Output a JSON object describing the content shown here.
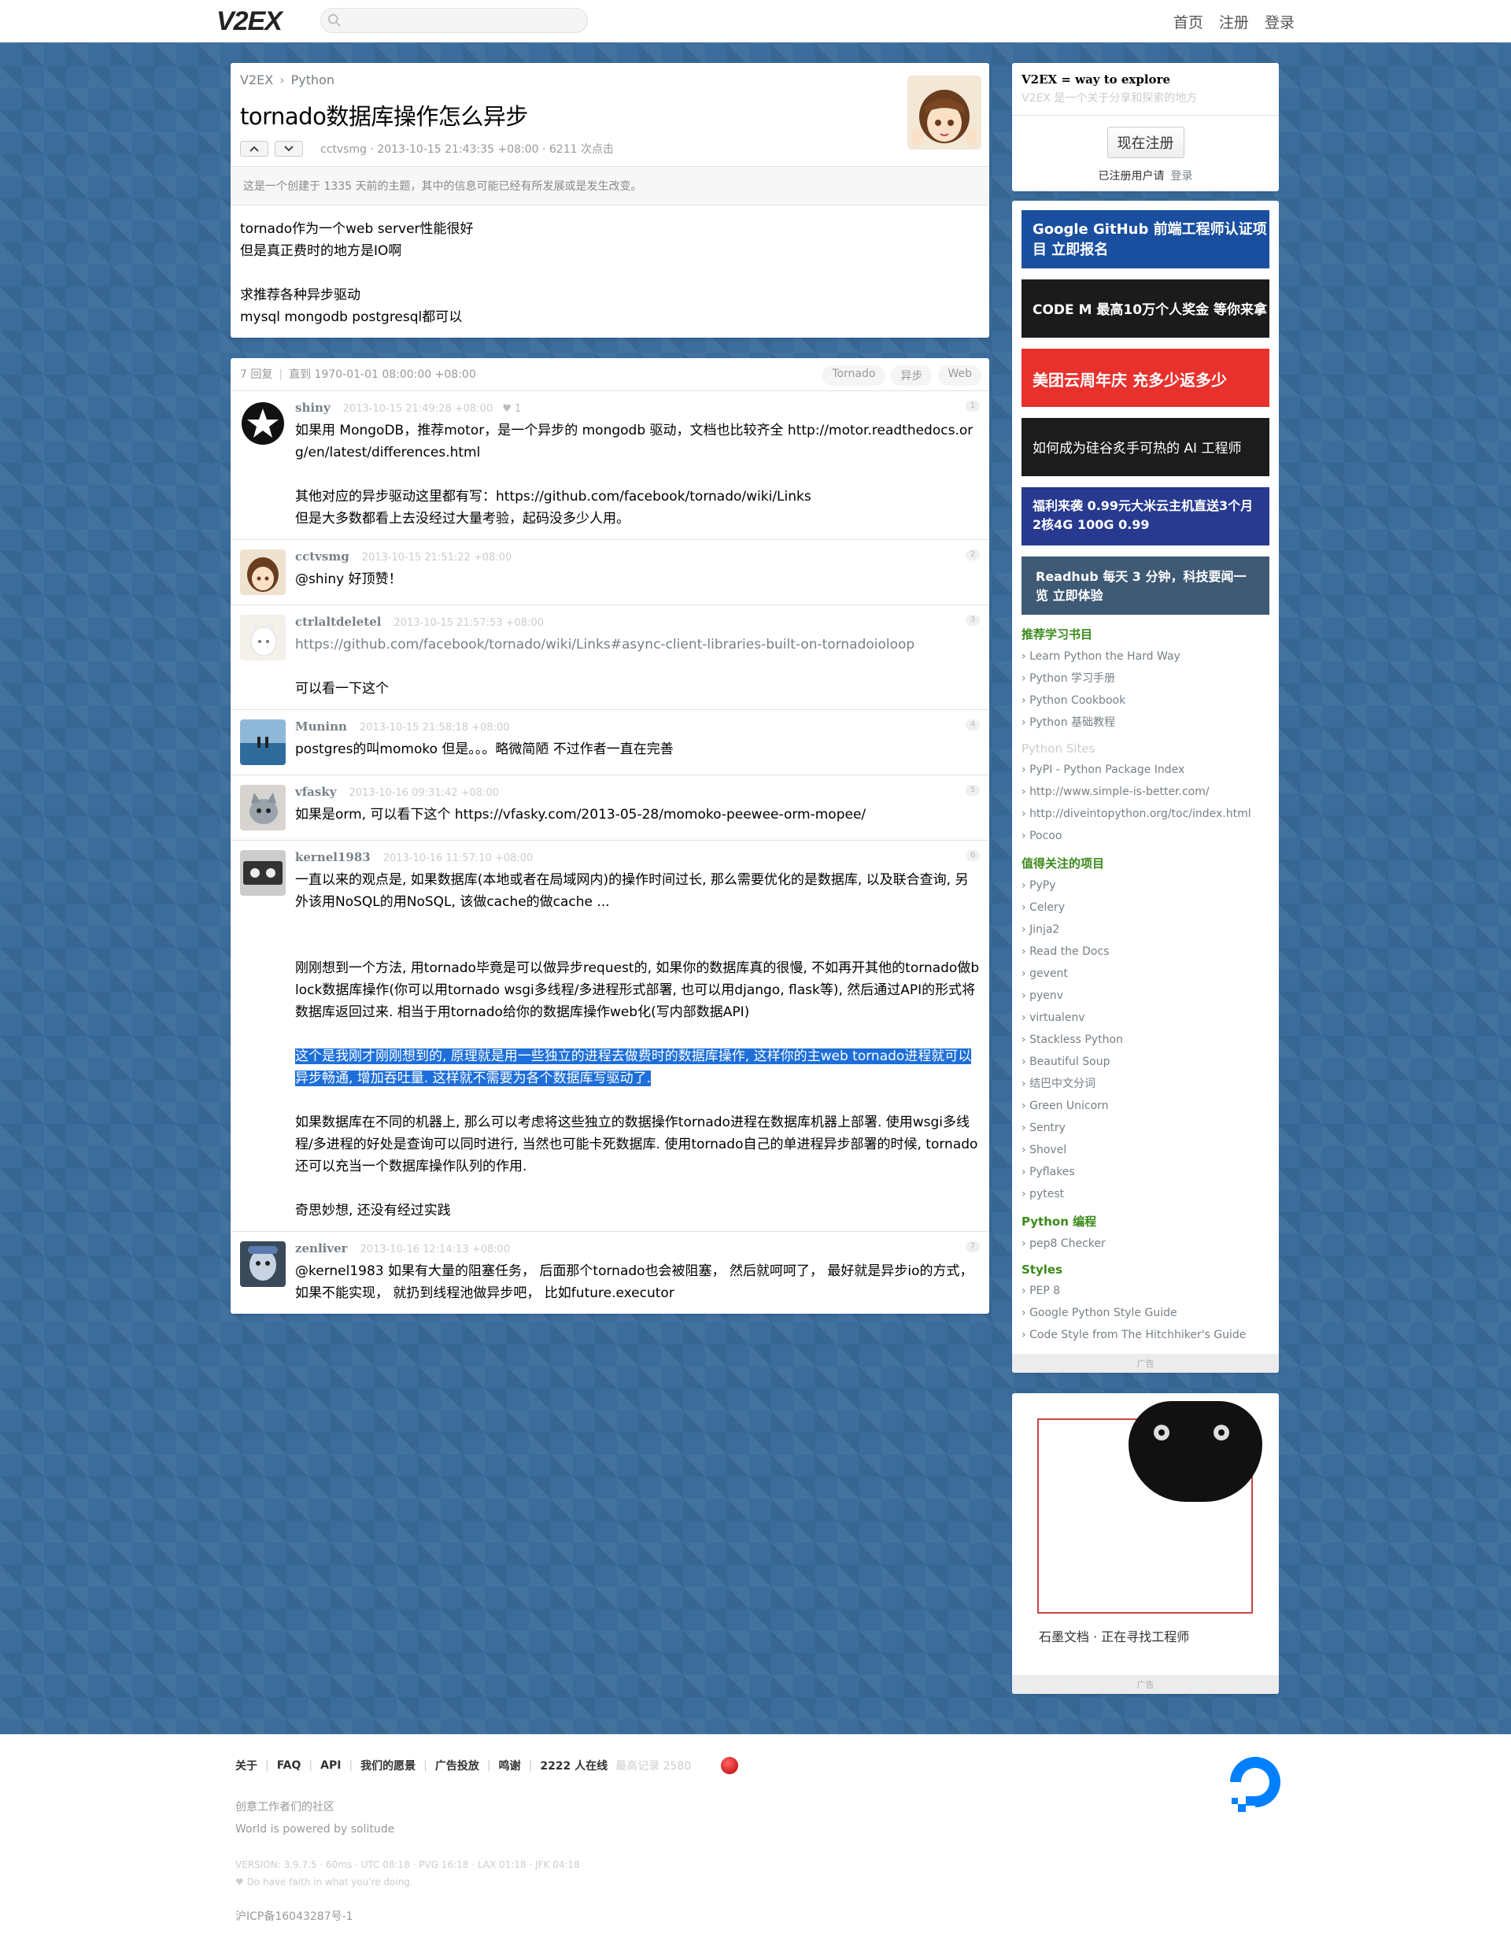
{
  "header": {
    "logo": "V2EX",
    "nav": [
      "首页",
      "注册",
      "登录"
    ]
  },
  "topic": {
    "breadcrumb": [
      "V2EX",
      "Python"
    ],
    "breadcrumb_sep": "›",
    "title": "tornado数据库操作怎么异步",
    "meta": "cctvsmg · 2013-10-15 21:43:35 +08:00 · 6211 次点击",
    "notice": "这是一个创建于 1335 天前的主题，其中的信息可能已经有所发展或是发生改变。",
    "content": [
      "tornado作为一个web server性能很好",
      "但是真正费时的地方是IO啊",
      "",
      "求推荐各种异步驱动",
      "mysql mongodb postgresql都可以"
    ]
  },
  "replies_header": {
    "count": "7 回复",
    "until": "直到 1970-01-01 08:00:00 +08:00",
    "tags": [
      "Tornado",
      "异步",
      "Web"
    ]
  },
  "replies": [
    {
      "name": "shiny",
      "time": "2013-10-15 21:49:28 +08:00",
      "heart": "♥ 1",
      "num": "1",
      "lines": [
        "如果用 MongoDB，推荐motor，是一个异步的 mongodb 驱动，文档也比较齐全 http://motor.readthedocs.org/en/latest/differences.html",
        "",
        "其他对应的异步驱动这里都有写：https://github.com/facebook/tornado/wiki/Links",
        "但是大多数都看上去没经过大量考验，起码没多少人用。"
      ]
    },
    {
      "name": "cctvsmg",
      "time": "2013-10-15 21:51:22 +08:00",
      "num": "2",
      "lines": [
        "@shiny 好顶赞！"
      ]
    },
    {
      "name": "ctrlaltdeletel",
      "time": "2013-10-15 21:57:53 +08:00",
      "num": "3",
      "lines": [
        "https://github.com/facebook/tornado/wiki/Links#async-client-libraries-built-on-tornadoioloop",
        "",
        "可以看一下这个"
      ]
    },
    {
      "name": "Muninn",
      "time": "2013-10-15 21:58:18 +08:00",
      "num": "4",
      "lines": [
        "postgres的叫momoko 但是。。。略微简陋 不过作者一直在完善"
      ]
    },
    {
      "name": "vfasky",
      "time": "2013-10-16 09:31:42 +08:00",
      "num": "5",
      "lines": [
        "如果是orm, 可以看下这个 https://vfasky.com/2013-05-28/momoko-peewee-orm-mopee/"
      ]
    },
    {
      "name": "kernel1983",
      "time": "2013-10-16 11:57:10 +08:00",
      "num": "6",
      "lines": [
        "一直以来的观点是, 如果数据库(本地或者在局域网内)的操作时间过长, 那么需要优化的是数据库, 以及联合查询, 另外该用NoSQL的用NoSQL, 该做cache的做cache ...",
        "",
        "",
        "刚刚想到一个方法, 用tornado毕竟是可以做异步request的, 如果你的数据库真的很慢, 不如再开其他的tornado做block数据库操作(你可以用tornado wsgi多线程/多进程形式部署, 也可以用django, flask等), 然后通过API的形式将数据库返回过来. 相当于用tornado给你的数据库操作web化(写内部数据API)",
        "",
        "这个是我刚才刚刚想到的, 原理就是用一些独立的进程去做费时的数据库操作, 这样你的主web tornado进程就可以异步畅通, 增加吞吐量. 这样就不需要为各个数据库写驱动了.",
        "",
        "如果数据库在不同的机器上, 那么可以考虑将这些独立的数据操作tornado进程在数据库机器上部署. 使用wsgi多线程/多进程的好处是查询可以同时进行, 当然也可能卡死数据库. 使用tornado自己的单进程异步部署的时候, tornado还可以充当一个数据库操作队列的作用.",
        "",
        "奇思妙想, 还没有经过实践"
      ]
    },
    {
      "name": "zenliver",
      "time": "2013-10-16 12:14:13 +08:00",
      "num": "7",
      "lines": [
        "@kernel1983 如果有大量的阻塞任务， 后面那个tornado也会被阻塞， 然后就呵呵了， 最好就是异步io的方式，如果不能实现， 就扔到线程池做异步吧， 比如future.executor"
      ]
    }
  ],
  "sidebar": {
    "title": "V2EX = way to explore",
    "subtitle": "V2EX 是一个关于分享和探索的地方",
    "register": "现在注册",
    "registered": "已注册用户请",
    "login": "登录",
    "ads": [
      {
        "text": "Google GitHub 前端工程师认证项目 立即报名",
        "color": "#1a4fa0"
      },
      {
        "text": "CODE M 最高10万个人奖金 等你来拿",
        "color": "#1b1b1b"
      },
      {
        "text": "美团云周年庆 充多少返多少",
        "color": "#e8312d"
      },
      {
        "text": "如何成为硅谷炙手可热的 AI 工程师",
        "color": "#1c1c1c"
      },
      {
        "text": "福利来袭 0.99元大米云主机直送3个月 2核4G 100G 0.99",
        "color": "#283a90"
      },
      {
        "text": "Readhub 每天 3 分钟，科技要闻一览 立即体验",
        "color": "#3f5a75"
      }
    ],
    "sections": [
      {
        "title": "推荐学习书目",
        "gray": false,
        "items": [
          "Learn Python the Hard Way",
          "Python 学习手册",
          "Python Cookbook",
          "Python 基础教程"
        ]
      },
      {
        "title": "Python Sites",
        "gray": true,
        "items": [
          "PyPI - Python Package Index",
          "http://www.simple-is-better.com/",
          "http://diveintopython.org/toc/index.html",
          "Pocoo"
        ]
      },
      {
        "title": "值得关注的项目",
        "gray": false,
        "items": [
          "PyPy",
          "Celery",
          "Jinja2",
          "Read the Docs",
          "gevent",
          "pyenv",
          "virtualenv",
          "Stackless Python",
          "Beautiful Soup",
          "结巴中文分词",
          "Green Unicorn",
          "Sentry",
          "Shovel",
          "Pyflakes",
          "pytest"
        ]
      },
      {
        "title": "Python 编程",
        "gray": false,
        "items": [
          "pep8 Checker"
        ]
      },
      {
        "title": "Styles",
        "gray": false,
        "items": [
          "PEP 8",
          "Google Python Style Guide",
          "Code Style from The Hitchhiker's Guide"
        ]
      }
    ],
    "ad_label": "广告",
    "ad2_caption": "石墨文档 · 正在寻找工程师"
  },
  "footer": {
    "links": [
      "关于",
      "FAQ",
      "API",
      "我们的愿景",
      "广告投放",
      "鸣谢"
    ],
    "online": "2222 人在线",
    "record": "最高记录 2580",
    "line1": "创意工作者们的社区",
    "line2": "World is powered by solitude",
    "version": "VERSION: 3.9.7.5 · 60ms · UTC 08:18 · PVG 16:18 · LAX 01:18 · JFK 04:18",
    "faith": "♥ Do have faith in what you're doing.",
    "icp": "沪ICP备16043287号-1"
  }
}
